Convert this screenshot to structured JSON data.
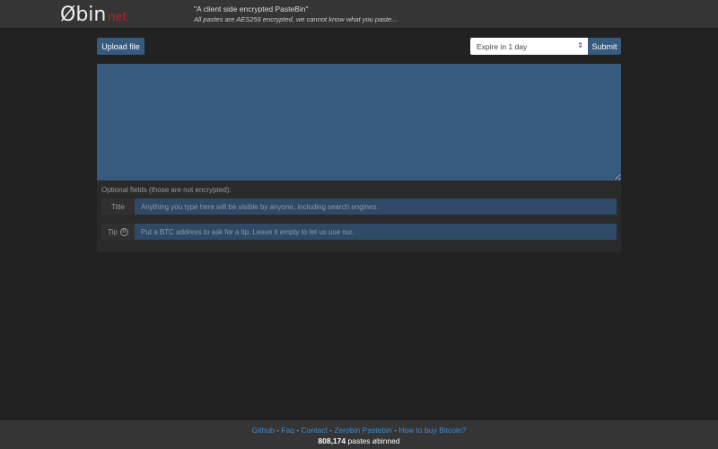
{
  "header": {
    "logo": "Øbin",
    "logo_suffix": "net",
    "tagline": "\"A client side encrypted PasteBin\"",
    "subtagline": "All pastes are AES256 encrypted, we cannot know what you paste..."
  },
  "toolbar": {
    "upload_label": "Upload file",
    "expire_selected": "Expire in 1 day",
    "submit_label": "Submit"
  },
  "optional": {
    "label": "Optional fields (those are not encrypted):",
    "title_label": "Title",
    "title_placeholder": "Anything you type here will be visible by anyone, including search engines.",
    "tip_label": "Tip",
    "tip_icon": "bitcoin-icon",
    "tip_placeholder": "Put a BTC address to ask for a tip. Leave it empty to let us use our."
  },
  "footer": {
    "links": [
      "Github",
      "Faq",
      "Contact",
      "Zerobin Pastebin",
      "How to buy Bitcoin?"
    ],
    "sep": " - ",
    "count": "808,174",
    "count_suffix": " pastes øbinned"
  },
  "colors": {
    "accent": "#375a7f",
    "link": "#3b8ed8",
    "logo_net": "#c0201f"
  }
}
